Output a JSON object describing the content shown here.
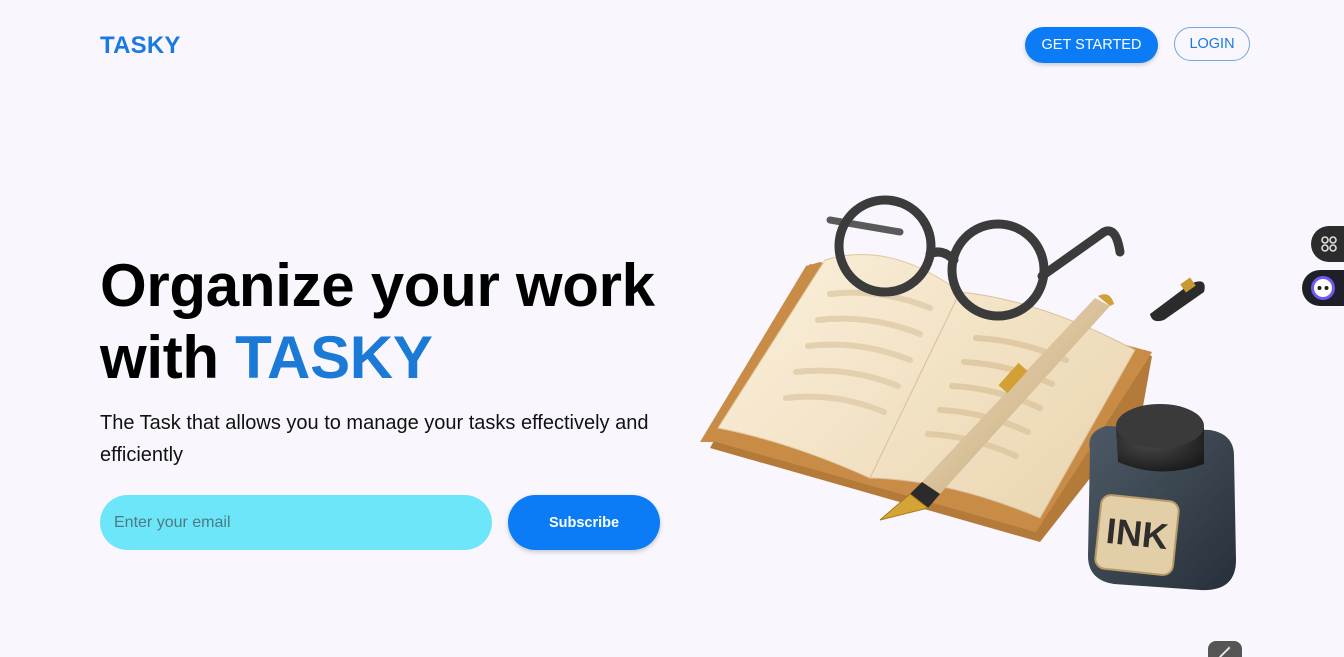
{
  "header": {
    "logo": "TASKY",
    "get_started_label": "GET STARTED",
    "login_label": "LOGIN"
  },
  "hero": {
    "title_line1": "Organize your work",
    "title_line2_prefix": "with",
    "title_brand": "TASKY",
    "subtitle": "The Task that allows you to manage your tasks effectively and efficiently",
    "email_placeholder": "Enter your email",
    "email_value": "",
    "subscribe_label": "Subscribe"
  },
  "illustration": {
    "ink_label": "INK"
  },
  "colors": {
    "brand_blue": "#1a7ae0",
    "button_blue": "#0b7cf6",
    "input_cyan": "#6ee6f9",
    "background": "#f9f7fd"
  },
  "icons": {
    "side_widget_1": "apps-grid-icon",
    "side_widget_2": "assistant-face-icon",
    "bottom_tool": "magic-wand-icon"
  }
}
